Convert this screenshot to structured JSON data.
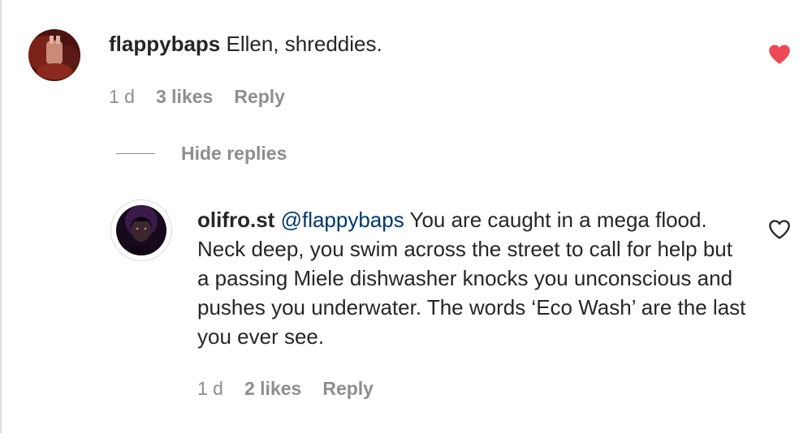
{
  "comments": [
    {
      "username": "flappybaps",
      "text": "Ellen, shreddies.",
      "time": "1 d",
      "likes": "3 likes",
      "reply_label": "Reply",
      "liked": true
    }
  ],
  "replies_toggle": {
    "label": "Hide replies"
  },
  "reply": {
    "username": "olifro.st",
    "mention": "@flappybaps",
    "text": "You are caught in a mega flood. Neck deep, you swim across the street to call for help but a passing Miele dishwasher knocks you unconscious and pushes you underwater. The words ‘Eco Wash’ are the last you ever see.",
    "time": "1 d",
    "likes": "2 likes",
    "reply_label": "Reply",
    "liked": false
  },
  "colors": {
    "text": "#262626",
    "muted": "#8e8e8e",
    "mention": "#00376b",
    "liked_heart": "#ed4956"
  },
  "icons": {
    "liked": "heart-filled-icon",
    "unliked": "heart-outline-icon"
  }
}
